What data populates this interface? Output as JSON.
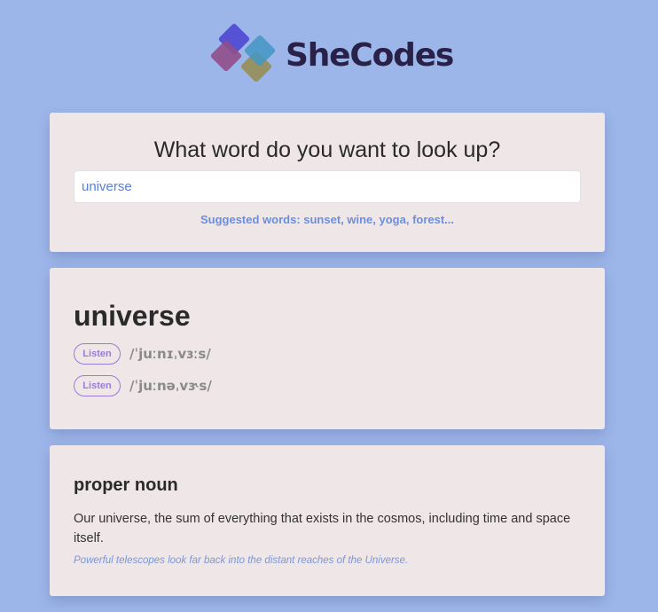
{
  "brand": {
    "name": "SheCodes",
    "logo_icon": "shecodes-diamond-logo",
    "text_color": "#2a2148"
  },
  "colors": {
    "background": "#9db6ea",
    "card": "#efe6e7",
    "accent_blue": "#6b8fe0",
    "accent_purple": "#9b7ad8"
  },
  "search": {
    "title": "What word do you want to look up?",
    "value": "universe",
    "suggestions": "Suggested words: sunset, wine, yoga, forest..."
  },
  "result": {
    "word": "universe",
    "phonetics": [
      {
        "button_label": "Listen",
        "text": "/ˈjuːnɪˌvɜːs/"
      },
      {
        "button_label": "Listen",
        "text": "/ˈjuːnəˌvɝs/"
      }
    ]
  },
  "meaning": {
    "part_of_speech": "proper noun",
    "definition": "Our universe, the sum of everything that exists in the cosmos, including time and space itself.",
    "example": "Powerful telescopes look far back into the distant reaches of the Universe."
  }
}
